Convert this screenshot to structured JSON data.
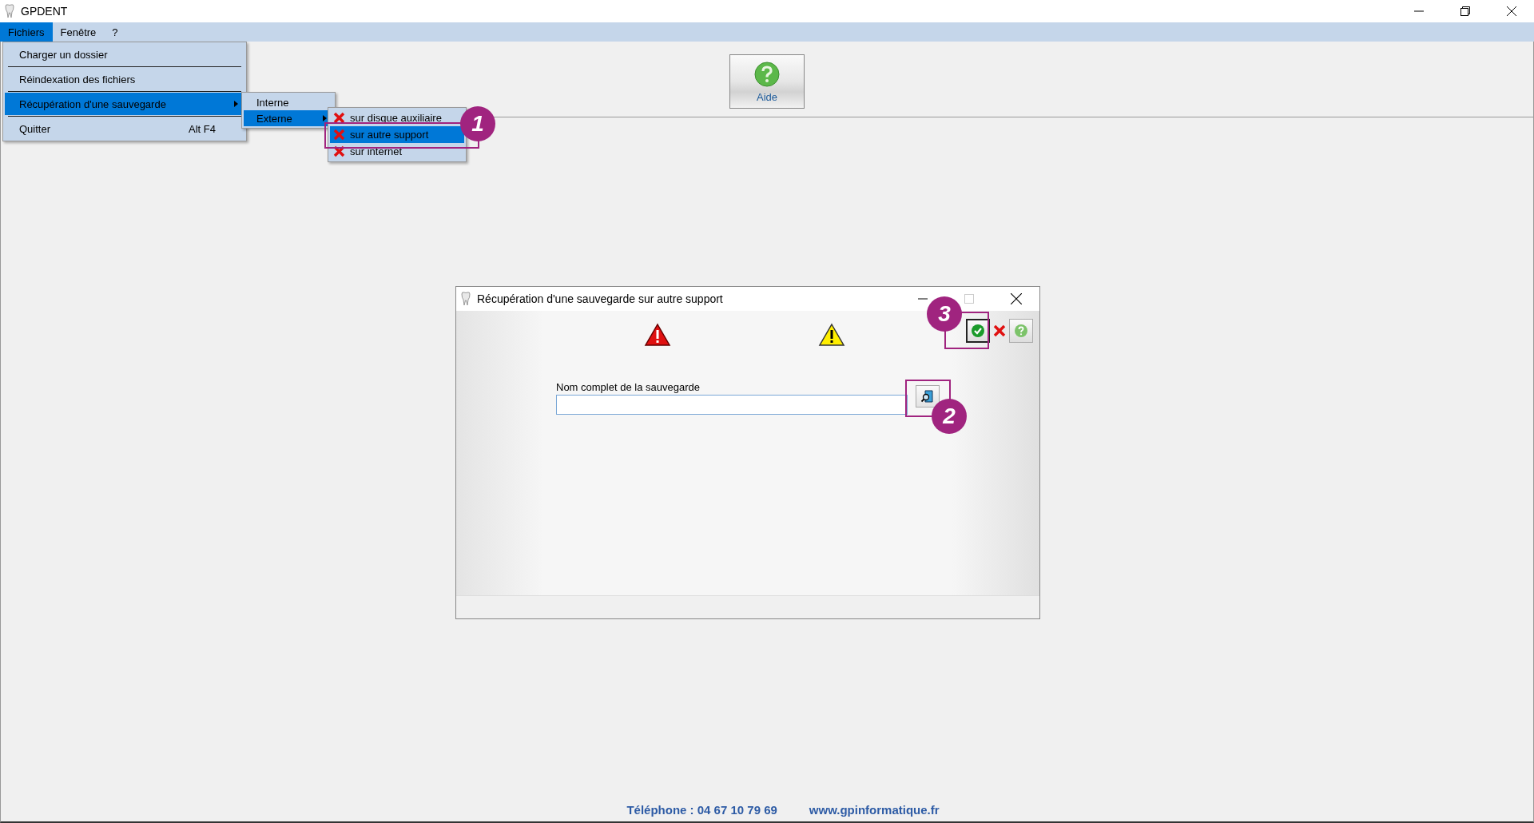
{
  "window": {
    "title": "GPDENT"
  },
  "menubar": [
    {
      "label": "Fichiers",
      "selected": true
    },
    {
      "label": "Fenêtre",
      "selected": false
    },
    {
      "label": "?",
      "selected": false
    }
  ],
  "file_menu": [
    {
      "label": "Charger un dossier",
      "selected": false,
      "submenu": false
    },
    {
      "label": "Réindexation des fichiers",
      "selected": false,
      "submenu": false
    },
    {
      "label": "Récupération d'une sauvegarde",
      "selected": true,
      "submenu": true
    },
    {
      "label": "Quitter",
      "shortcut": "Alt F4",
      "selected": false,
      "submenu": false
    }
  ],
  "restore_menu": [
    {
      "label": "Interne",
      "selected": false,
      "submenu": false
    },
    {
      "label": "Externe",
      "selected": true,
      "submenu": true
    }
  ],
  "external_menu": [
    {
      "label": "sur disque auxiliaire",
      "selected": false
    },
    {
      "label": "sur autre support",
      "selected": true
    },
    {
      "label": "sur internet",
      "selected": false
    }
  ],
  "toolbar": [
    {
      "label": "Aide"
    }
  ],
  "dialog": {
    "title": "Récupération d'une sauvegarde sur autre support",
    "field_label": "Nom complet de la sauvegarde"
  },
  "footer": {
    "phone": "Téléphone : 04 67 10 79 69",
    "website": "www.gpinformatique.fr"
  },
  "annotations": [
    {
      "number": "1"
    },
    {
      "number": "2"
    },
    {
      "number": "3"
    }
  ]
}
